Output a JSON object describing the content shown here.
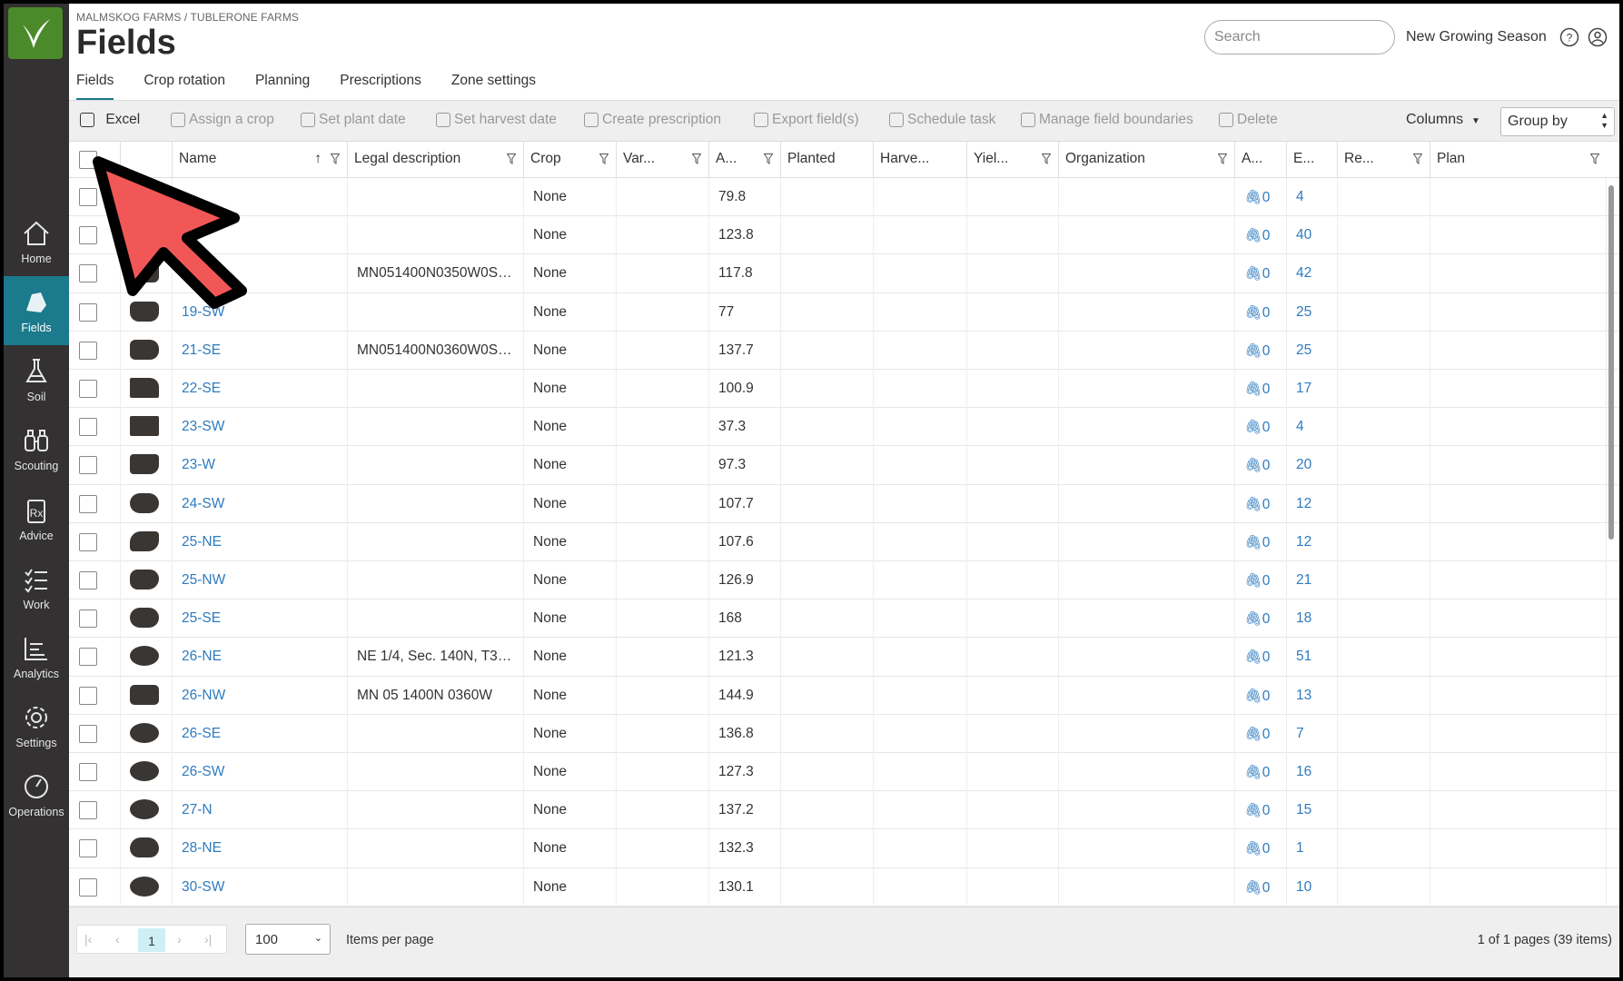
{
  "breadcrumb": "MALMSKOG FARMS / TUBLERONE FARMS",
  "page_title": "Fields",
  "search": {
    "placeholder": "Search"
  },
  "season": "New Growing Season",
  "sidebar": {
    "items": [
      {
        "label": "Home",
        "icon": "home-icon"
      },
      {
        "label": "Fields",
        "icon": "field-icon",
        "active": true
      },
      {
        "label": "Soil",
        "icon": "flask-icon"
      },
      {
        "label": "Scouting",
        "icon": "binoculars-icon"
      },
      {
        "label": "Advice",
        "icon": "prescription-icon"
      },
      {
        "label": "Work",
        "icon": "checklist-icon"
      },
      {
        "label": "Analytics",
        "icon": "chart-icon"
      },
      {
        "label": "Settings",
        "icon": "gear-icon"
      },
      {
        "label": "Operations",
        "icon": "gauge-icon"
      }
    ]
  },
  "tabs": [
    "Fields",
    "Crop rotation",
    "Planning",
    "Prescriptions",
    "Zone settings"
  ],
  "toolbar": {
    "excel": "Excel",
    "assign_crop": "Assign a crop",
    "set_plant_date": "Set plant date",
    "set_harvest_date": "Set harvest date",
    "create_prescription": "Create prescription",
    "export_fields": "Export field(s)",
    "schedule_task": "Schedule task",
    "manage_boundaries": "Manage field boundaries",
    "delete": "Delete",
    "columns": "Columns",
    "group_by": "Group by"
  },
  "columns": {
    "name": "Name",
    "legal": "Legal description",
    "crop": "Crop",
    "variety": "Var...",
    "area": "A...",
    "planted": "Planted",
    "harvested": "Harve...",
    "yield": "Yiel...",
    "organization": "Organization",
    "attachments": "A...",
    "events": "E...",
    "re": "Re...",
    "plan": "Plan"
  },
  "rows": [
    {
      "name": "",
      "legal": "",
      "crop": "None",
      "area": "79.8",
      "att": "0",
      "ev": "4"
    },
    {
      "name": "",
      "legal": "",
      "crop": "None",
      "area": "123.8",
      "att": "0",
      "ev": "40"
    },
    {
      "name": "",
      "legal": "MN051400N0350W0SN...",
      "crop": "None",
      "area": "117.8",
      "att": "0",
      "ev": "42"
    },
    {
      "name": "19-SW",
      "legal": "",
      "crop": "None",
      "area": "77",
      "att": "0",
      "ev": "25"
    },
    {
      "name": "21-SE",
      "legal": "MN051400N0360W0SN...",
      "crop": "None",
      "area": "137.7",
      "att": "0",
      "ev": "25"
    },
    {
      "name": "22-SE",
      "legal": "",
      "crop": "None",
      "area": "100.9",
      "att": "0",
      "ev": "17"
    },
    {
      "name": "23-SW",
      "legal": "",
      "crop": "None",
      "area": "37.3",
      "att": "0",
      "ev": "4"
    },
    {
      "name": "23-W",
      "legal": "",
      "crop": "None",
      "area": "97.3",
      "att": "0",
      "ev": "20"
    },
    {
      "name": "24-SW",
      "legal": "",
      "crop": "None",
      "area": "107.7",
      "att": "0",
      "ev": "12"
    },
    {
      "name": "25-NE",
      "legal": "",
      "crop": "None",
      "area": "107.6",
      "att": "0",
      "ev": "12"
    },
    {
      "name": "25-NW",
      "legal": "",
      "crop": "None",
      "area": "126.9",
      "att": "0",
      "ev": "21"
    },
    {
      "name": "25-SE",
      "legal": "",
      "crop": "None",
      "area": "168",
      "att": "0",
      "ev": "18"
    },
    {
      "name": "26-NE",
      "legal": "NE 1/4, Sec. 140N, T36...",
      "crop": "None",
      "area": "121.3",
      "att": "0",
      "ev": "51"
    },
    {
      "name": "26-NW",
      "legal": "MN 05 1400N 0360W",
      "crop": "None",
      "area": "144.9",
      "att": "0",
      "ev": "13"
    },
    {
      "name": "26-SE",
      "legal": "",
      "crop": "None",
      "area": "136.8",
      "att": "0",
      "ev": "7"
    },
    {
      "name": "26-SW",
      "legal": "",
      "crop": "None",
      "area": "127.3",
      "att": "0",
      "ev": "16"
    },
    {
      "name": "27-N",
      "legal": "",
      "crop": "None",
      "area": "137.2",
      "att": "0",
      "ev": "15"
    },
    {
      "name": "28-NE",
      "legal": "",
      "crop": "None",
      "area": "132.3",
      "att": "0",
      "ev": "1"
    },
    {
      "name": "30-SW",
      "legal": "",
      "crop": "None",
      "area": "130.1",
      "att": "0",
      "ev": "10"
    }
  ],
  "footer": {
    "current_page": "1",
    "per_page": "100",
    "per_page_label": "Items per page",
    "page_info": "1 of 1 pages (39 items)"
  },
  "colors": {
    "accent": "#1b7a8c",
    "link": "#2e7bbf",
    "sidebar": "#333131",
    "cursor": "#f25757"
  }
}
